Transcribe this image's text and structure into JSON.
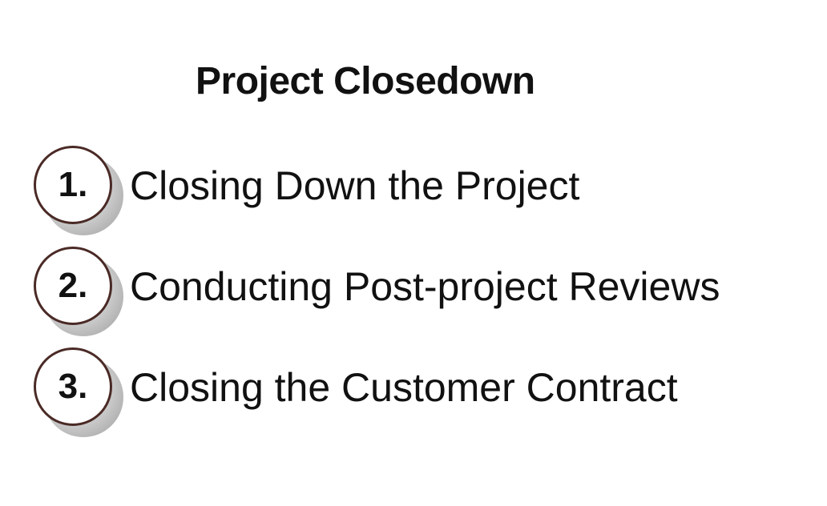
{
  "title": "Project Closedown",
  "steps": [
    {
      "number": "1.",
      "label": "Closing Down the Project"
    },
    {
      "number": "2.",
      "label": "Conducting Post-project Reviews"
    },
    {
      "number": "3.",
      "label": "Closing the Customer Contract"
    }
  ],
  "colors": {
    "circle_border": "#4a2a26",
    "shadow": "#9a9a9a",
    "text": "#111111",
    "background": "#ffffff"
  }
}
